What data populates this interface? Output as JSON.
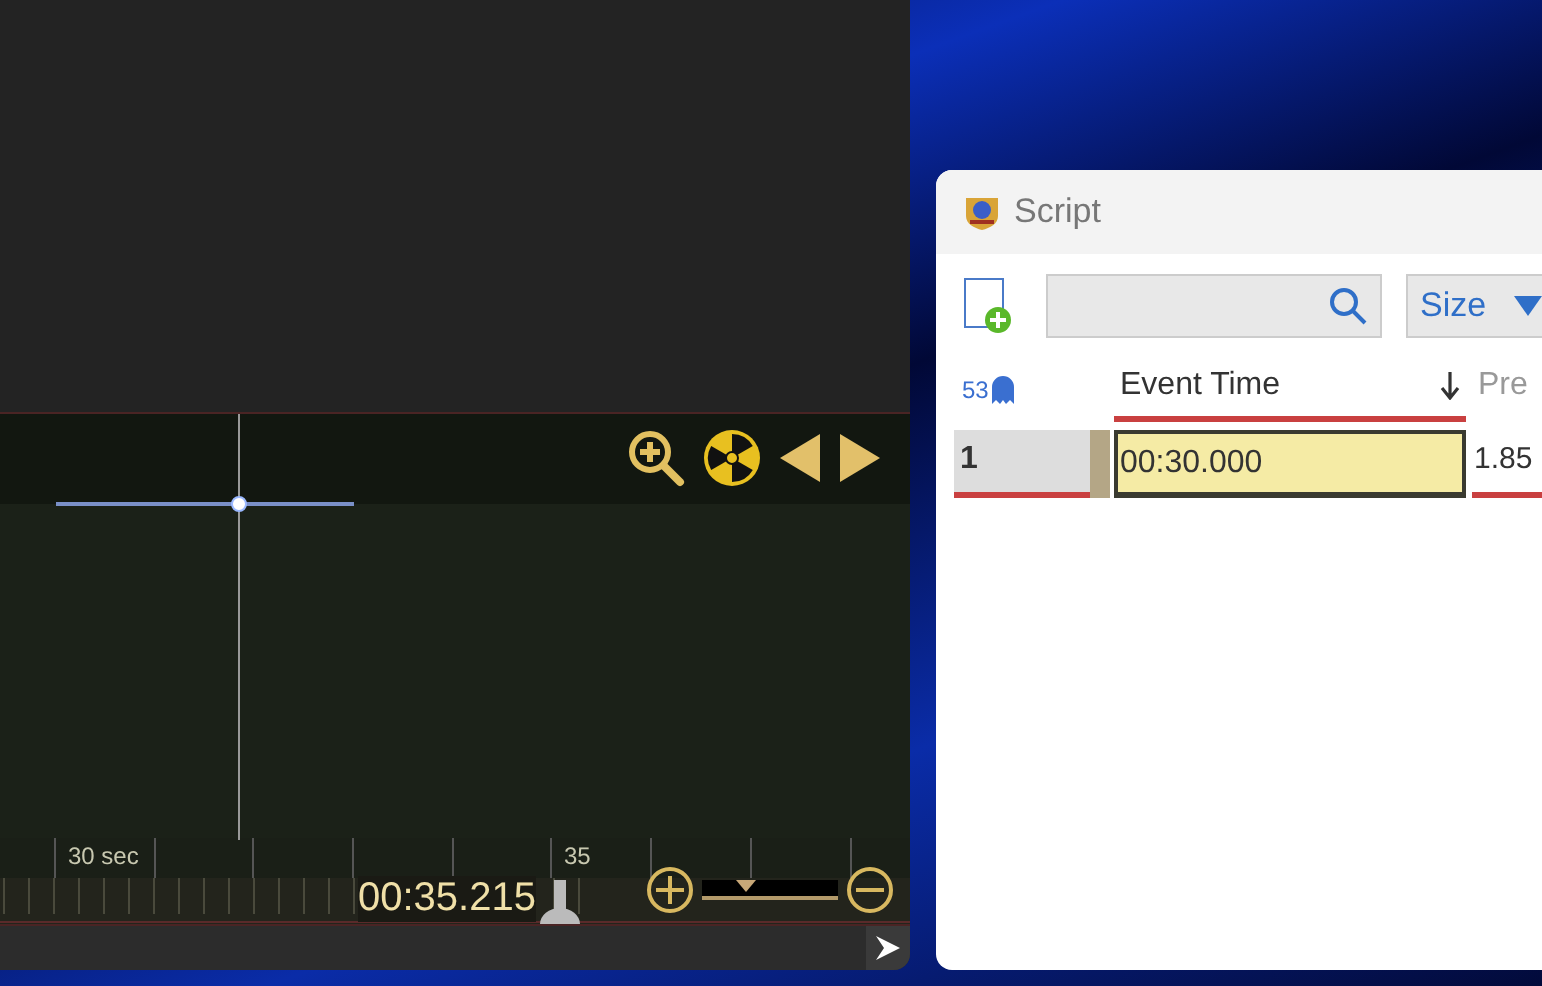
{
  "timeline": {
    "ruler_labels": [
      "30 sec",
      "35"
    ],
    "playhead_time": "00:35.215",
    "zoom_slider": {
      "level": 0.3
    }
  },
  "script_window": {
    "title": "Script",
    "size_dropdown": {
      "value": "Size"
    },
    "event_count": "53",
    "columns": [
      {
        "label": "Event Time",
        "sorted": true
      },
      {
        "label": "Pre",
        "sorted": false
      }
    ],
    "rows": [
      {
        "number": "1",
        "cells": [
          {
            "text": "00:30.000",
            "selected": true
          },
          {
            "text": "1.85",
            "selected": false
          }
        ]
      }
    ]
  }
}
